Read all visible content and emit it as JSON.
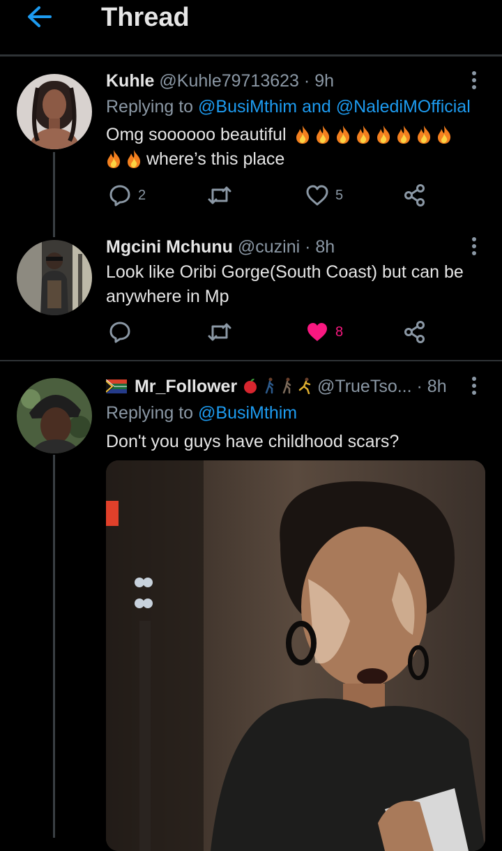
{
  "header": {
    "title": "Thread"
  },
  "tweets": [
    {
      "name": "Kuhle",
      "handle": "@Kuhle79713623",
      "time": "· 9h",
      "replying_prefix": "Replying to",
      "replying_to_1": "@BusiMthim",
      "replying_and": "and",
      "replying_to_2": "@NalediMOfficial",
      "text_1": "Omg soooooo beautiful",
      "text_2": "where’s this place",
      "replies": "2",
      "likes": "5"
    },
    {
      "name": "Mgcini Mchunu",
      "handle": "@cuzini",
      "time": "· 8h",
      "text": "Look like Oribi Gorge(South Coast) but can be anywhere in Mp",
      "likes": "8"
    },
    {
      "name": "Mr_Follower",
      "handle": "@TrueTso...",
      "time": "· 8h",
      "replying_prefix": "Replying to",
      "replying_to_1": "@BusiMthim",
      "text": "Don't you guys have childhood scars?"
    }
  ],
  "icons": [
    "back-arrow-icon",
    "more-icon",
    "reply-icon",
    "retweet-icon",
    "like-icon",
    "share-icon",
    "fire-emoji-icon",
    "flag-icon",
    "apple-icon",
    "walking-icon",
    "running-icon"
  ],
  "colors": {
    "accent": "#1d9bf0",
    "like": "#f91880",
    "muted": "#8b98a5",
    "background": "#000000"
  }
}
